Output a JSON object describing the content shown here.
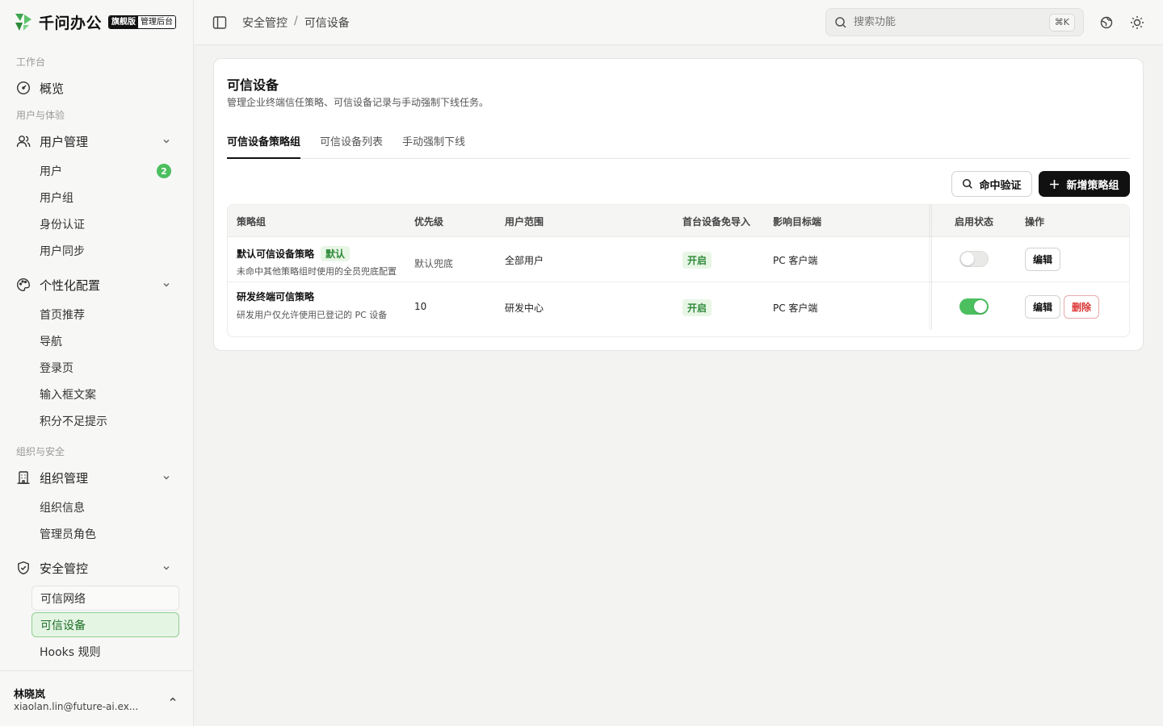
{
  "brand": {
    "name": "千问办公",
    "edition": "旗舰版",
    "console": "管理后台"
  },
  "nav": {
    "sec_workspace": "工作台",
    "overview": "概览",
    "sec_users": "用户与体验",
    "user_mgmt": "用户管理",
    "users": "用户",
    "users_badge": "2",
    "user_groups": "用户组",
    "auth": "身份认证",
    "user_sync": "用户同步",
    "personalize": "个性化配置",
    "home_rec": "首页推荐",
    "navigation": "导航",
    "login_page": "登录页",
    "input_copy": "输入框文案",
    "points_tip": "积分不足提示",
    "sec_org": "组织与安全",
    "org_mgmt": "组织管理",
    "org_info": "组织信息",
    "admin_roles": "管理员角色",
    "security": "安全管控",
    "trusted_network": "可信网络",
    "trusted_devices": "可信设备",
    "hooks": "Hooks 规则"
  },
  "user": {
    "name": "林晓岚",
    "email": "xiaolan.lin@future-ai.ex..."
  },
  "topbar": {
    "crumb_1": "安全管控",
    "crumb_sep": "/",
    "crumb_2": "可信设备",
    "search_placeholder": "搜索功能",
    "shortcut": "⌘K"
  },
  "page": {
    "title": "可信设备",
    "desc": "管理企业终端信任策略、可信设备记录与手动强制下线任务。",
    "tabs": [
      "可信设备策略组",
      "可信设备列表",
      "手动强制下线"
    ],
    "btn_verify": "命中验证",
    "btn_add": "新增策略组"
  },
  "table": {
    "headers": [
      "策略组",
      "优先级",
      "用户范围",
      "首台设备免导入",
      "影响目标端",
      "启用状态",
      "操作"
    ],
    "rows": [
      {
        "name": "默认可信设备策略",
        "tag": "默认",
        "desc": "未命中其他策略组时使用的全员兜底配置",
        "priority": "默认兜底",
        "scope": "全部用户",
        "first_device": "开启",
        "target": "PC 客户端",
        "enabled": false,
        "actions": [
          "编辑"
        ]
      },
      {
        "name": "研发终端可信策略",
        "tag": "",
        "desc": "研发用户仅允许使用已登记的 PC 设备",
        "priority": "10",
        "scope": "研发中心",
        "first_device": "开启",
        "target": "PC 客户端",
        "enabled": true,
        "actions": [
          "编辑",
          "删除"
        ]
      }
    ]
  },
  "colors": {
    "accent": "#4cbf5f",
    "active_bg": "#e5f5e4",
    "danger": "#d33333",
    "dark": "#111111"
  }
}
